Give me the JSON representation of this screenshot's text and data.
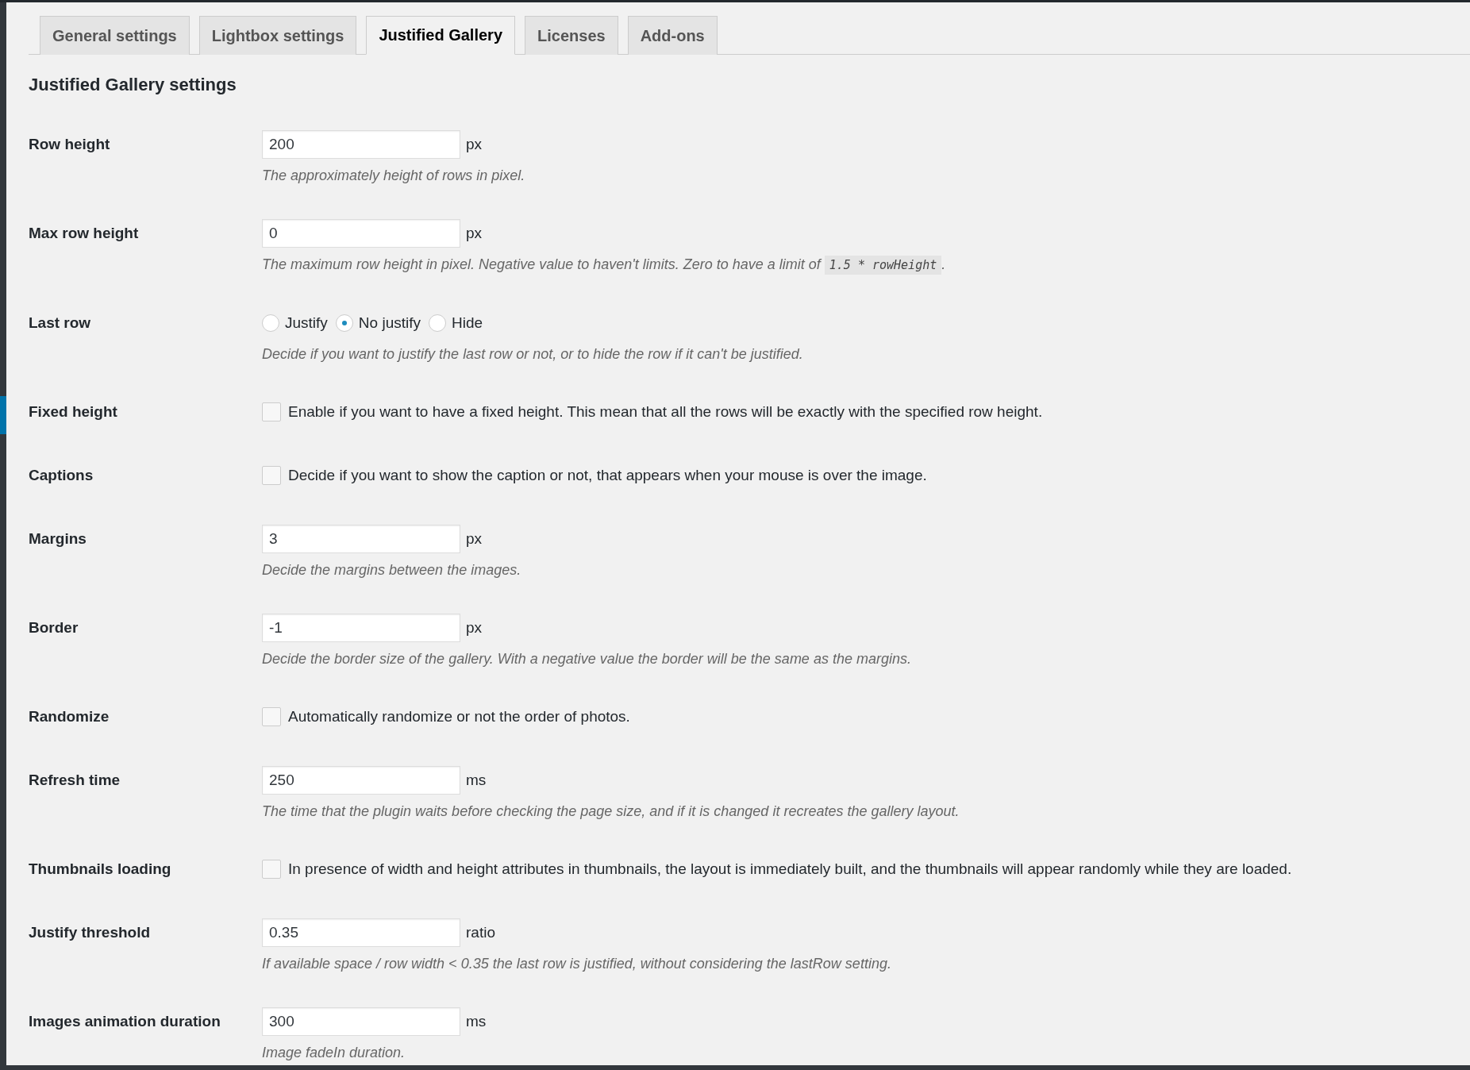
{
  "tabs": [
    {
      "label": "General settings",
      "selected": false
    },
    {
      "label": "Lightbox settings",
      "selected": false
    },
    {
      "label": "Justified Gallery",
      "selected": true
    },
    {
      "label": "Licenses",
      "selected": false
    },
    {
      "label": "Add-ons",
      "selected": false
    }
  ],
  "heading": "Justified Gallery settings",
  "settings": [
    {
      "kind": "number",
      "label": "Row height",
      "value": "200",
      "unit": "px",
      "description": "The approximately height of rows in pixel."
    },
    {
      "kind": "number",
      "label": "Max row height",
      "value": "0",
      "unit": "px",
      "description": "The maximum row height in pixel. Negative value to haven't limits. Zero to have a limit of",
      "description_code": "1.5 * rowHeight",
      "description_after": "."
    },
    {
      "kind": "radio",
      "label": "Last row",
      "options": [
        {
          "label": "Justify",
          "selected": false
        },
        {
          "label": "No justify",
          "selected": true
        },
        {
          "label": "Hide",
          "selected": false
        }
      ],
      "description": "Decide if you want to justify the last row or not, or to hide the row if it can't be justified."
    },
    {
      "kind": "checkbox",
      "label": "Fixed height",
      "checked": false,
      "text": "Enable if you want to have a fixed height. This mean that all the rows will be exactly with the specified row height."
    },
    {
      "kind": "checkbox",
      "label": "Captions",
      "checked": false,
      "text": "Decide if you want to show the caption or not, that appears when your mouse is over the image."
    },
    {
      "kind": "number",
      "label": "Margins",
      "value": "3",
      "unit": "px",
      "description": "Decide the margins between the images."
    },
    {
      "kind": "number",
      "label": "Border",
      "value": "-1",
      "unit": "px",
      "description": "Decide the border size of the gallery. With a negative value the border will be the same as the margins."
    },
    {
      "kind": "checkbox",
      "label": "Randomize",
      "checked": false,
      "text": "Automatically randomize or not the order of photos."
    },
    {
      "kind": "number",
      "label": "Refresh time",
      "value": "250",
      "unit": "ms",
      "description": "The time that the plugin waits before checking the page size, and if it is changed it recreates the gallery layout."
    },
    {
      "kind": "checkbox",
      "label": "Thumbnails loading",
      "checked": false,
      "text": "In presence of width and height attributes in thumbnails, the layout is immediately built, and the thumbnails will appear randomly while they are loaded."
    },
    {
      "kind": "number",
      "label": "Justify threshold",
      "value": "0.35",
      "unit": "ratio",
      "description": "If available space / row width < 0.35 the last row is justified, without considering the lastRow setting."
    },
    {
      "kind": "number",
      "label": "Images animation duration",
      "value": "300",
      "unit": "ms",
      "description": "Image fadeIn duration."
    }
  ]
}
